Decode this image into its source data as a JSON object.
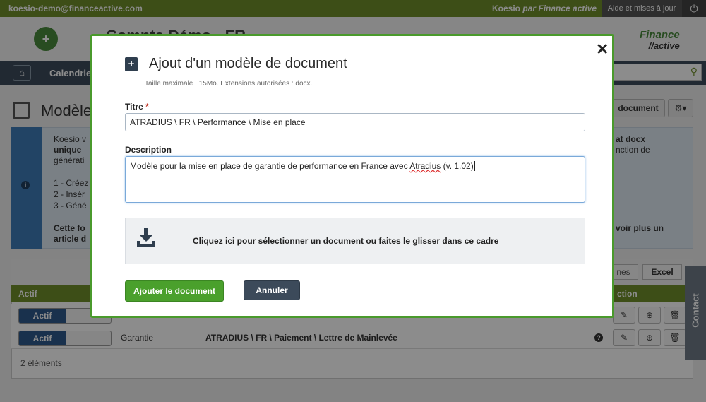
{
  "topbar": {
    "user": "koesio-demo@financeactive.com",
    "brand_prefix": "Koesio",
    "brand_suffix": "par Finance active",
    "help": "Aide et mises à jour"
  },
  "header": {
    "app_title": "Compte Démo - FR",
    "logo_line1": "Finance",
    "logo_line2": "//active"
  },
  "navbar": {
    "item": "Calendrier"
  },
  "page": {
    "title": "Modèles",
    "add_button": "document"
  },
  "info": {
    "line1": "Koesio v",
    "line2": "unique",
    "line3": "générati",
    "step1": "1 - Créez",
    "step2": "2 - Insér",
    "step3": "3 - Géné",
    "bold1": "Cette fo",
    "bold2": "article d",
    "right1": "at docx",
    "right2": "nction de",
    "right3": "voir plus un"
  },
  "table": {
    "lignes_button": "nes",
    "excel_button": "Excel",
    "head_actif": "Actif",
    "head_action": "ction",
    "rows": [
      {
        "status": "Actif",
        "type": "",
        "name": ""
      },
      {
        "status": "Actif",
        "type": "Garantie",
        "name": "ATRADIUS \\ FR \\ Paiement \\ Lettre de Mainlevée"
      }
    ],
    "count": "2 éléments"
  },
  "contact": "Contact",
  "modal": {
    "title": "Ajout d'un modèle de document",
    "subtitle": "Taille maximale : 15Mo. Extensions autorisées : docx.",
    "title_label": "Titre",
    "required_mark": "*",
    "title_value": "ATRADIUS \\ FR \\ Performance \\ Mise en place",
    "description_label": "Description",
    "description_before": "Modèle pour la mise en place de garantie de performance en France avec ",
    "description_misspelled": "Atradius",
    "description_after": " (v. 1.02)",
    "dropzone_text": "Cliquez ici pour sélectionner un document ou faites le glisser dans ce cadre",
    "submit_button": "Ajouter le document",
    "cancel_button": "Annuler",
    "close_glyph": "✕"
  },
  "colors": {
    "accent_green": "#6f8f2a",
    "modal_border": "#4a9a2c",
    "primary_button": "#4aa02c",
    "cancel_button": "#3c4a5a",
    "info_strip": "#3f7db8"
  }
}
